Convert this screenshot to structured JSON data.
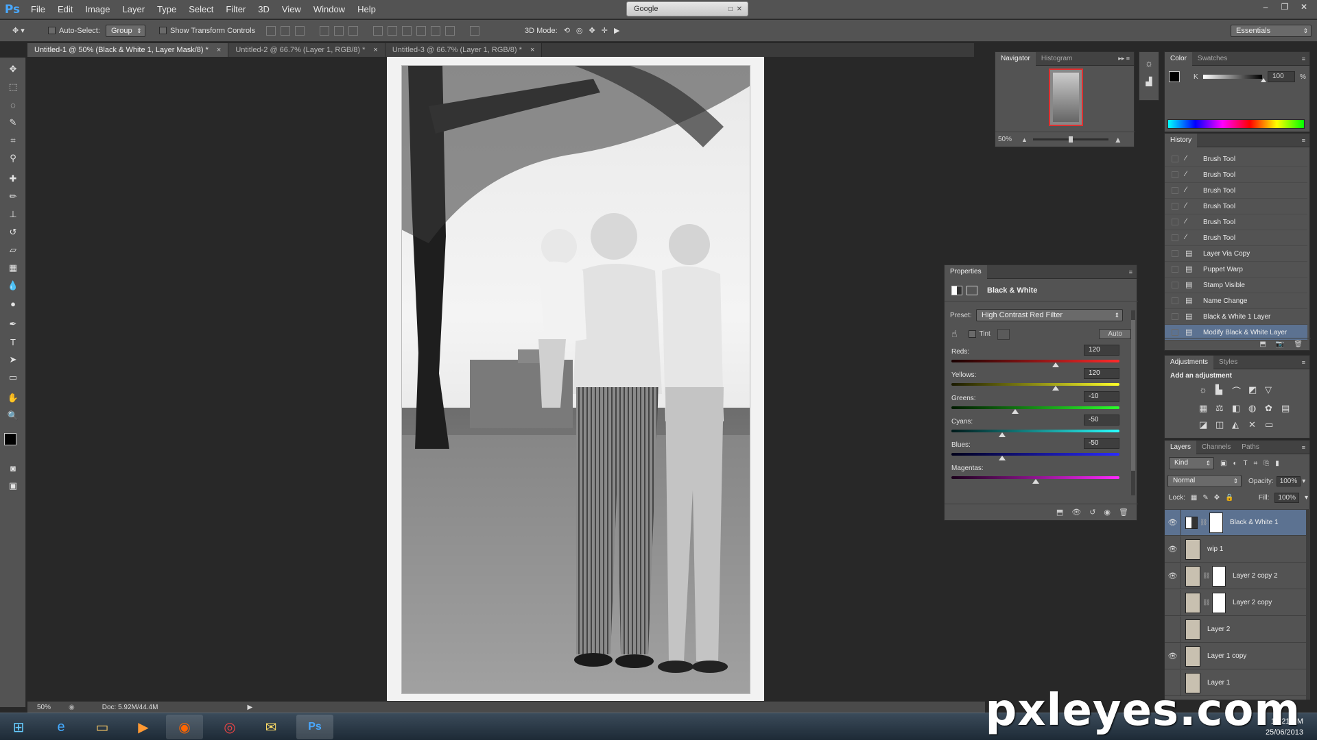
{
  "app": {
    "logo": "Ps"
  },
  "menu": [
    "File",
    "Edit",
    "Image",
    "Layer",
    "Type",
    "Select",
    "Filter",
    "3D",
    "View",
    "Window",
    "Help"
  ],
  "browser_box": {
    "title": "Google"
  },
  "window_controls": {
    "minimize": "–",
    "restore": "❐",
    "close": "✕"
  },
  "options": {
    "auto_select_label": "Auto-Select:",
    "auto_select_value": "Group",
    "transform_label": "Show Transform Controls",
    "mode_3d_label": "3D Mode:",
    "workspace": "Essentials"
  },
  "tabs": [
    {
      "label": "Untitled-1 @ 50% (Black & White 1, Layer Mask/8) *",
      "close": "×"
    },
    {
      "label": "Untitled-2 @ 66.7% (Layer 1, RGB/8) *",
      "close": "×"
    },
    {
      "label": "Untitled-3 @ 66.7% (Layer 1, RGB/8) *",
      "close": "×"
    }
  ],
  "status": {
    "zoom": "50%",
    "doc": "Doc: 5.92M/44.4M",
    "arrow": "▶"
  },
  "navigator": {
    "tab1": "Navigator",
    "tab2": "Histogram",
    "zoom": "50%",
    "zoom_level": 0.5
  },
  "color_panel": {
    "tab1": "Color",
    "tab2": "Swatches",
    "channel": "K",
    "value": "100",
    "unit": "%"
  },
  "history": {
    "tab": "History",
    "items": [
      {
        "label": "Brush Tool",
        "icon": "brush-icon"
      },
      {
        "label": "Brush Tool",
        "icon": "brush-icon"
      },
      {
        "label": "Brush Tool",
        "icon": "brush-icon"
      },
      {
        "label": "Brush Tool",
        "icon": "brush-icon"
      },
      {
        "label": "Brush Tool",
        "icon": "brush-icon"
      },
      {
        "label": "Brush Tool",
        "icon": "brush-icon"
      },
      {
        "label": "Layer Via Copy",
        "icon": "document-icon"
      },
      {
        "label": "Puppet Warp",
        "icon": "document-icon"
      },
      {
        "label": "Stamp Visible",
        "icon": "document-icon"
      },
      {
        "label": "Name Change",
        "icon": "document-icon"
      },
      {
        "label": "Black & White 1 Layer",
        "icon": "document-icon"
      },
      {
        "label": "Modify Black & White Layer",
        "icon": "document-icon"
      }
    ]
  },
  "adjustments": {
    "tab1": "Adjustments",
    "tab2": "Styles",
    "heading": "Add an adjustment"
  },
  "layers_panel": {
    "tab1": "Layers",
    "tab2": "Channels",
    "tab3": "Paths",
    "kind": "Kind",
    "blend": "Normal",
    "opacity_label": "Opacity:",
    "opacity": "100%",
    "lock_label": "Lock:",
    "fill_label": "Fill:",
    "fill": "100%",
    "layers": [
      {
        "name": "Black & White 1",
        "visible": true,
        "mask": true,
        "adjustment": true,
        "selected": true
      },
      {
        "name": "wip 1",
        "visible": true,
        "mask": false
      },
      {
        "name": "Layer 2 copy 2",
        "visible": true,
        "mask": true
      },
      {
        "name": "Layer 2 copy",
        "visible": false,
        "mask": true
      },
      {
        "name": "Layer 2",
        "visible": false,
        "mask": false
      },
      {
        "name": "Layer 1 copy",
        "visible": true,
        "mask": false
      },
      {
        "name": "Layer 1",
        "visible": false,
        "mask": false
      }
    ]
  },
  "properties": {
    "tab": "Properties",
    "title": "Black & White",
    "preset_label": "Preset:",
    "preset": "High Contrast Red Filter",
    "tint_label": "Tint",
    "auto_label": "Auto",
    "sliders": [
      {
        "label": "Reds:",
        "value": "120",
        "fraction": 0.62,
        "gradient": "linear-gradient(90deg,#1a0000,#ff2a2a)"
      },
      {
        "label": "Yellows:",
        "value": "120",
        "fraction": 0.62,
        "gradient": "linear-gradient(90deg,#1a1a00,#ffff2a)"
      },
      {
        "label": "Greens:",
        "value": "-10",
        "fraction": 0.38,
        "gradient": "linear-gradient(90deg,#001a00,#2aff2a)"
      },
      {
        "label": "Cyans:",
        "value": "-50",
        "fraction": 0.3,
        "gradient": "linear-gradient(90deg,#001a1a,#2affff)"
      },
      {
        "label": "Blues:",
        "value": "-50",
        "fraction": 0.3,
        "gradient": "linear-gradient(90deg,#00001a,#2a2aff)"
      },
      {
        "label": "Magentas:",
        "value": "",
        "fraction": 0.5,
        "gradient": "linear-gradient(90deg,#1a001a,#ff2aff)"
      }
    ]
  },
  "taskbar": {
    "time": "12:21 PM",
    "date": "25/06/2013"
  },
  "watermark": "pxleyes.com",
  "colors": {
    "accent": "#5c7291",
    "panel": "#535353",
    "ps_blue": "#49a8ff"
  }
}
